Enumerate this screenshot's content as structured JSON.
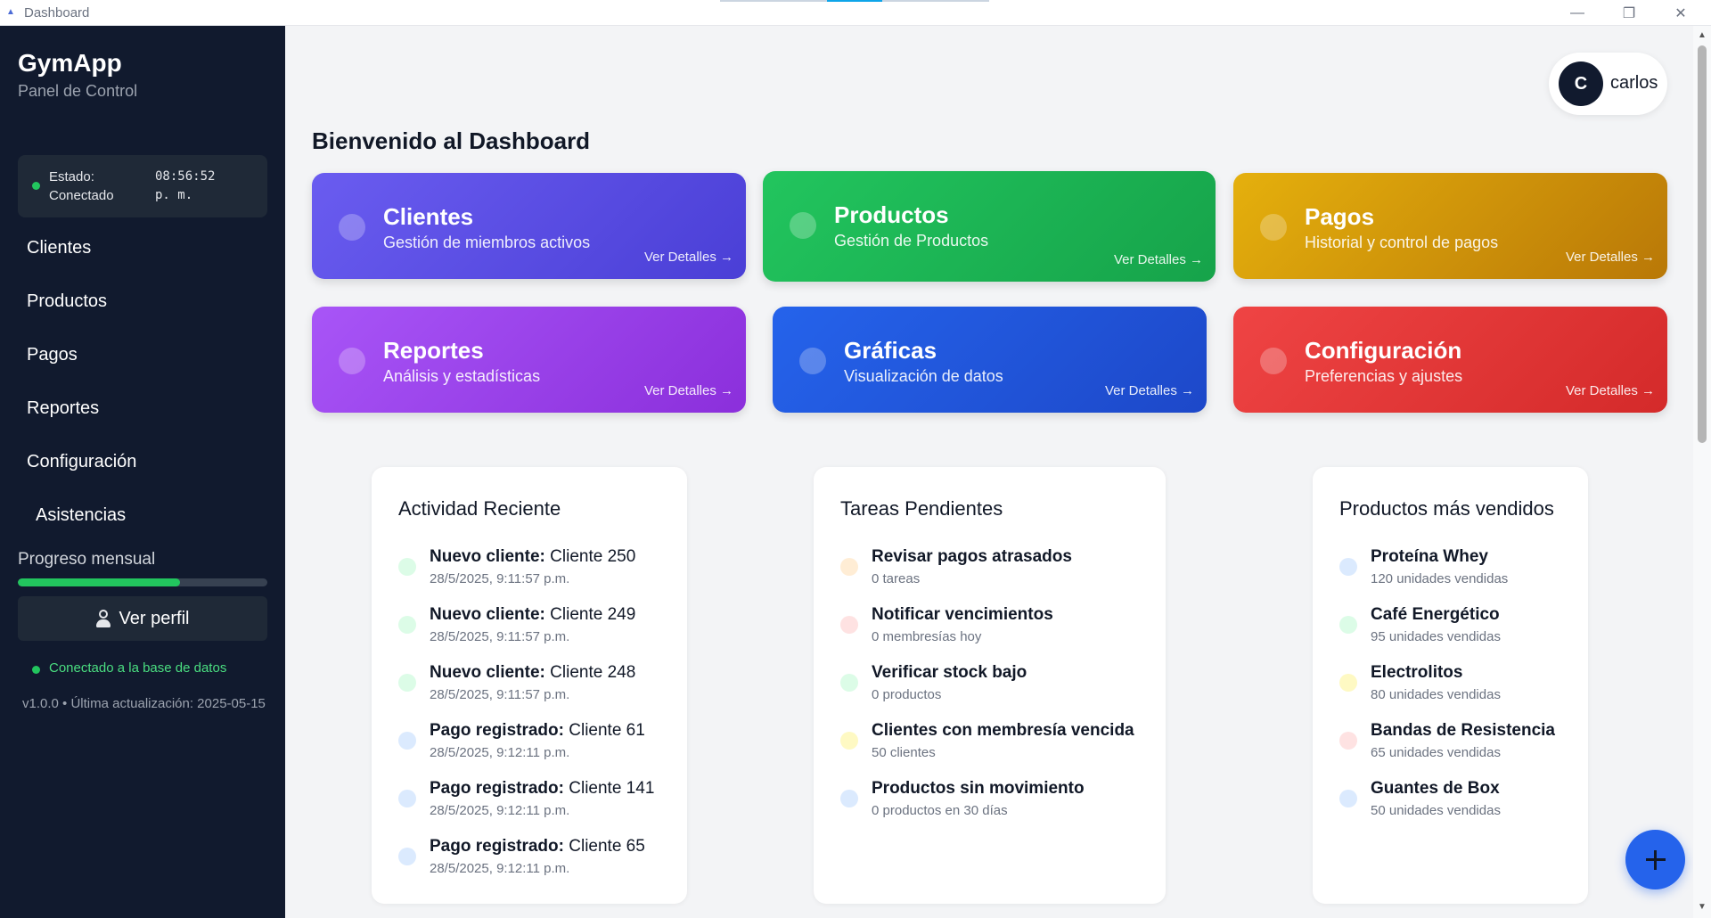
{
  "window": {
    "title": "Dashboard",
    "minimize": "—",
    "maximize": "❐",
    "close": "✕"
  },
  "sidebar": {
    "brand": "GymApp",
    "subtitle": "Panel de Control",
    "status_label": "Estado: Conectado",
    "status_label_line1": "Estado:",
    "status_label_line2": "Conectado",
    "status_time_line1": "08:56:52",
    "status_time_line2": "p. m.",
    "items": [
      {
        "label": "Clientes"
      },
      {
        "label": "Productos"
      },
      {
        "label": "Pagos"
      },
      {
        "label": "Reportes"
      },
      {
        "label": "Configuración"
      },
      {
        "label": "Asistencias"
      }
    ],
    "progress_label": "Progreso mensual",
    "progress_fraction": 0.65,
    "profile_button": "Ver perfil",
    "db_status": "Conectado a la base de datos",
    "version": "v1.0.0 • Última actualización: 2025-05-15"
  },
  "user": {
    "initial": "C",
    "name": "carlos"
  },
  "page_title": "Bienvenido al Dashboard",
  "cards": [
    {
      "title": "Clientes",
      "subtitle": "Gestión de miembros activos",
      "link": "Ver Detalles →",
      "color": "#5b4de0"
    },
    {
      "title": "Productos",
      "subtitle": "Gestión de Productos",
      "link": "Ver Detalles →",
      "color": "#1fae52"
    },
    {
      "title": "Pagos",
      "subtitle": "Historial y control de pagos",
      "link": "Ver Detalles →",
      "color": "#d49a09"
    },
    {
      "title": "Reportes",
      "subtitle": "Análisis y estadísticas",
      "link": "Ver Detalles →",
      "color": "#9a3ee3"
    },
    {
      "title": "Gráficas",
      "subtitle": "Visualización de datos",
      "link": "Ver Detalles →",
      "color": "#1f56dd"
    },
    {
      "title": "Configuración",
      "subtitle": "Preferencias y ajustes",
      "link": "Ver Detalles →",
      "color": "#e53535"
    }
  ],
  "activity": {
    "title": "Actividad Reciente",
    "items": [
      {
        "bold": "Nuevo cliente:",
        "text": " Cliente 250",
        "sub": "28/5/2025, 9:11:57 p.m."
      },
      {
        "bold": "Nuevo cliente:",
        "text": " Cliente 249",
        "sub": "28/5/2025, 9:11:57 p.m."
      },
      {
        "bold": "Nuevo cliente:",
        "text": " Cliente 248",
        "sub": "28/5/2025, 9:11:57 p.m."
      },
      {
        "bold": "Pago registrado:",
        "text": " Cliente 61",
        "sub": "28/5/2025, 9:12:11 p.m."
      },
      {
        "bold": "Pago registrado:",
        "text": " Cliente 141",
        "sub": "28/5/2025, 9:12:11 p.m."
      },
      {
        "bold": "Pago registrado:",
        "text": " Cliente 65",
        "sub": "28/5/2025, 9:12:11 p.m."
      }
    ]
  },
  "tasks": {
    "title": "Tareas Pendientes",
    "items": [
      {
        "bold": "Revisar pagos atrasados",
        "sub": "0 tareas"
      },
      {
        "bold": "Notificar vencimientos",
        "sub": "0 membresías hoy"
      },
      {
        "bold": "Verificar stock bajo",
        "sub": "0 productos"
      },
      {
        "bold": "Clientes con membresía vencida",
        "sub": "50 clientes"
      },
      {
        "bold": "Productos sin movimiento",
        "sub": "0 productos en 30 días"
      }
    ]
  },
  "products": {
    "title": "Productos más vendidos",
    "items": [
      {
        "bold": "Proteína Whey",
        "sub": "120 unidades vendidas"
      },
      {
        "bold": "Café Energético",
        "sub": "95 unidades vendidas"
      },
      {
        "bold": "Electrolitos",
        "sub": "80 unidades vendidas"
      },
      {
        "bold": "Bandas de Resistencia",
        "sub": "65 unidades vendidas"
      },
      {
        "bold": "Guantes de Box",
        "sub": "50 unidades vendidas"
      }
    ]
  },
  "fab_icon": "plus-icon"
}
